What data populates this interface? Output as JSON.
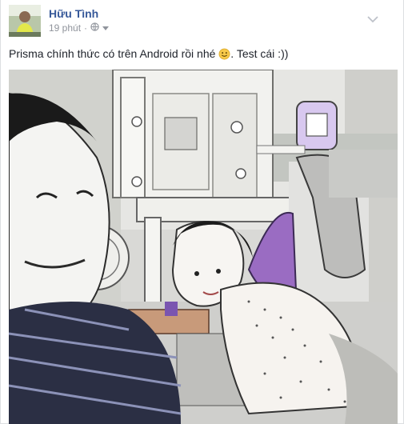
{
  "post": {
    "author": "Hữu Tình",
    "timestamp": "19 phút",
    "separator": "·",
    "privacy_icon": "globe-icon",
    "menu_icon": "chevron-down-icon",
    "text": "Prisma chính thức có trên Android rồi nhé",
    "text_suffix": ". Test cái :))",
    "emoji": "smile-emoji",
    "photo_icon": "photo-image"
  },
  "colors": {
    "author": "#365899",
    "meta": "#90949c",
    "text": "#1d2129"
  }
}
